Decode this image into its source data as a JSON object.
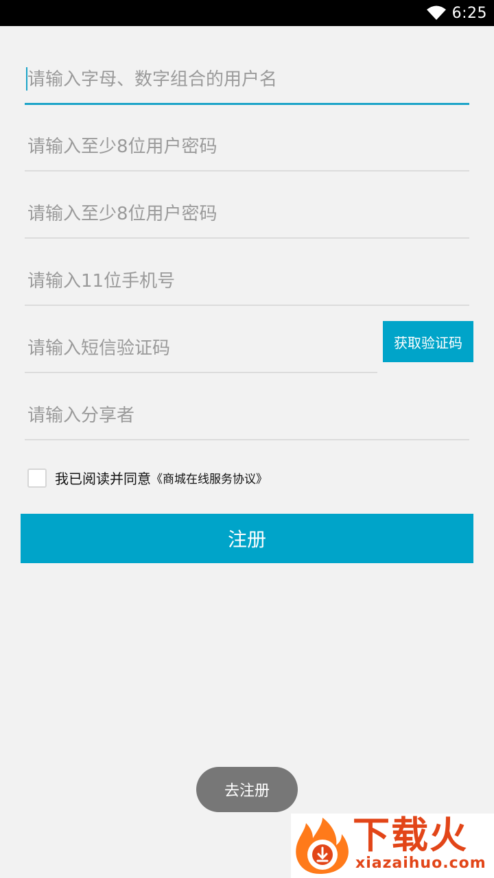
{
  "status_bar": {
    "time": "6:25",
    "icons": [
      "wifi-icon"
    ]
  },
  "form": {
    "username": {
      "value": "",
      "placeholder": "请输入字母、数字组合的用户名"
    },
    "password": {
      "value": "",
      "placeholder": "请输入至少8位用户密码"
    },
    "password_confirm": {
      "value": "",
      "placeholder": "请输入至少8位用户密码"
    },
    "phone": {
      "value": "",
      "placeholder": "请输入11位手机号"
    },
    "sms_code": {
      "value": "",
      "placeholder": "请输入短信验证码"
    },
    "sms_button_label": "获取验证码",
    "sharer": {
      "value": "",
      "placeholder": "请输入分享者"
    }
  },
  "agreement": {
    "checked": false,
    "text": "我已阅读并同意",
    "link_text": "《商城在线服务协议》"
  },
  "register_button_label": "注册",
  "toast": {
    "text": "去注册"
  },
  "watermark": {
    "title": "下载火",
    "url": "xiazaihuo.com"
  },
  "colors": {
    "accent": "#00a4c9",
    "focus_underline": "#1aa3c8",
    "background": "#f2f2f2",
    "watermark": "#e24518"
  }
}
